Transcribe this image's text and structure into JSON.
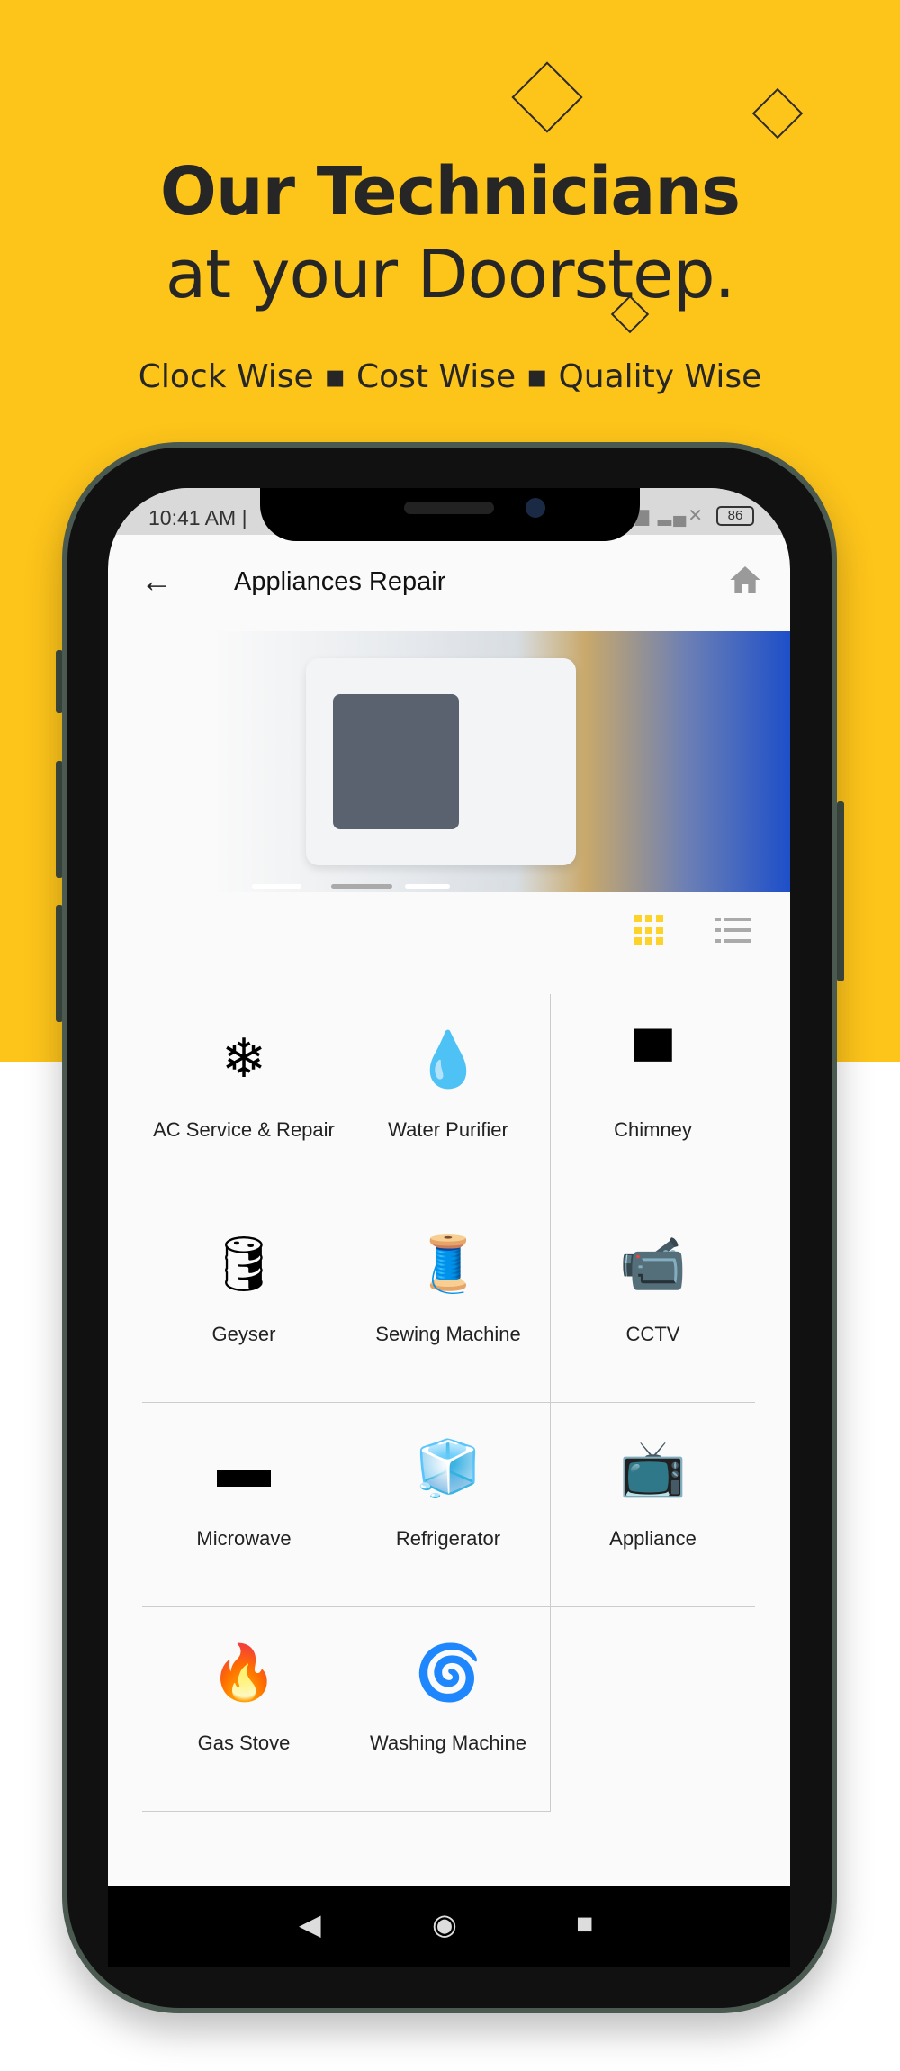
{
  "hero": {
    "title_line1": "Our Technicians",
    "title_line2": "at your Doorstep.",
    "tagline": "Clock Wise ▪ Cost Wise ▪ Quality Wise",
    "color": "#FDC41A"
  },
  "status_bar": {
    "time": "10:41 AM | ",
    "battery": "86"
  },
  "app_bar": {
    "title": "Appliances Repair",
    "back_icon": "arrow-left-icon",
    "home_icon": "home-icon"
  },
  "view_toggle": {
    "active": "grid",
    "accent": "#FDD32B"
  },
  "categories": [
    {
      "label": "AC Service & Repair",
      "icon": "❄"
    },
    {
      "label": "Water Purifier",
      "icon": "💧"
    },
    {
      "label": "Chimney",
      "icon": "▀"
    },
    {
      "label": "Geyser",
      "icon": "🛢"
    },
    {
      "label": "Sewing Machine",
      "icon": "🧵"
    },
    {
      "label": "CCTV",
      "icon": "📹"
    },
    {
      "label": "Microwave",
      "icon": "▬"
    },
    {
      "label": "Refrigerator",
      "icon": "🧊"
    },
    {
      "label": "Appliance",
      "icon": "📺"
    },
    {
      "label": "Gas Stove",
      "icon": "🔥"
    },
    {
      "label": "Washing Machine",
      "icon": "🌀"
    }
  ],
  "nav": {
    "back": "◀",
    "home": "◉",
    "recents": "■"
  }
}
